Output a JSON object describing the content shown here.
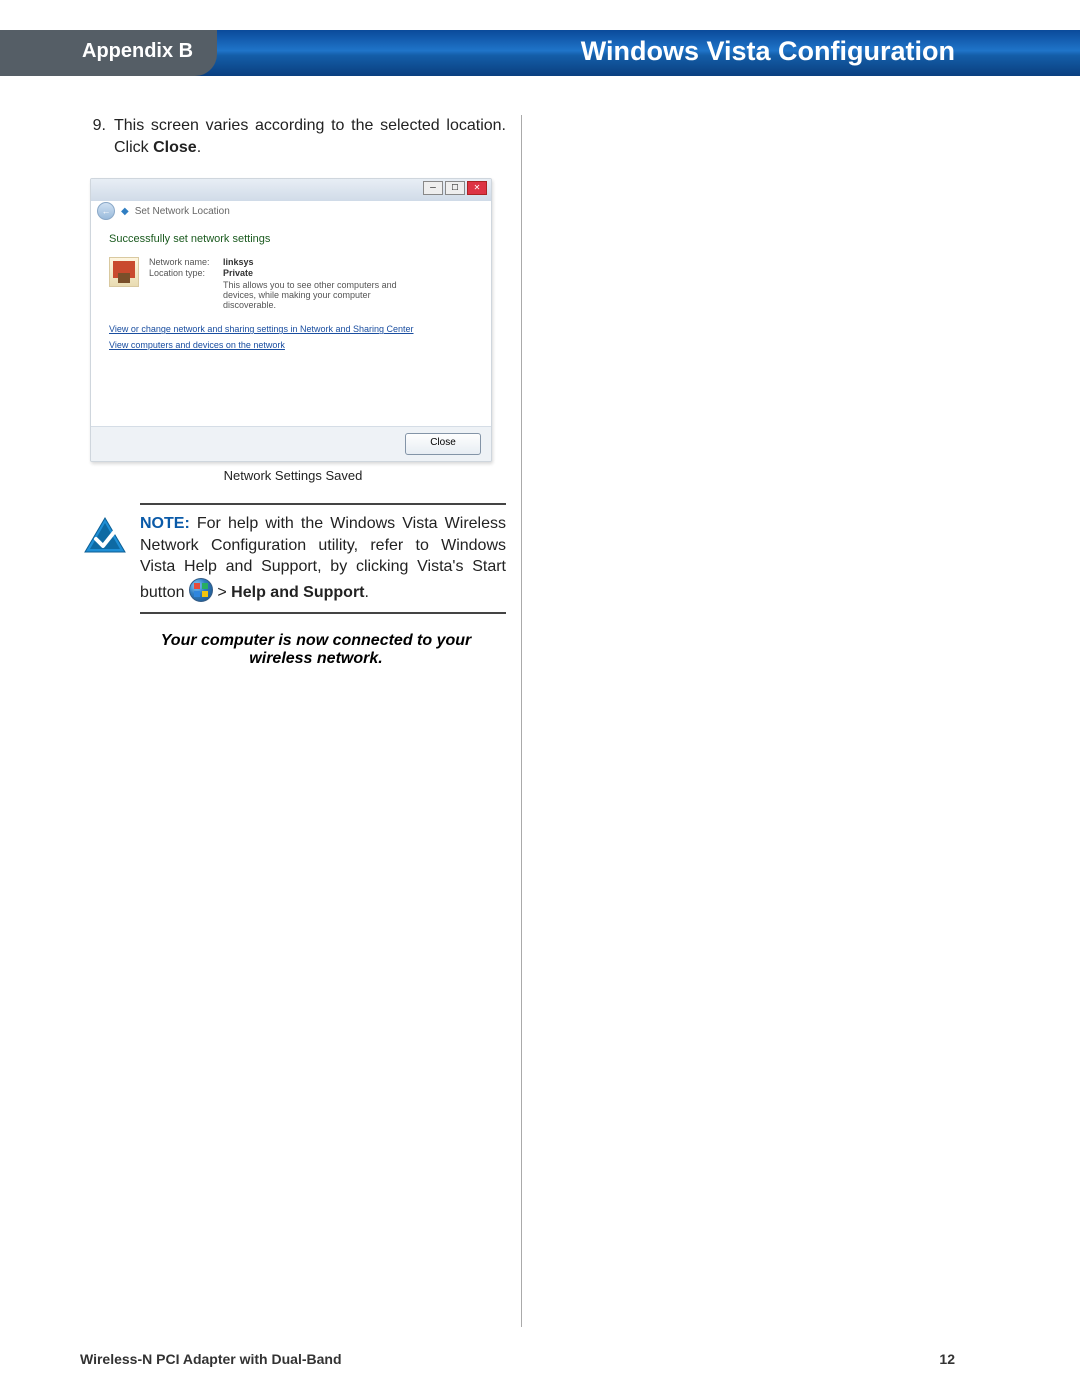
{
  "header": {
    "appendix": "Appendix B",
    "title": "Windows Vista Configuration"
  },
  "step": {
    "number": "9.",
    "text_pre": "This screen varies according to the selected location. Click ",
    "text_bold": "Close",
    "text_post": "."
  },
  "screenshot": {
    "window_title": "Set Network Location",
    "heading": "Successfully set network settings",
    "labels": {
      "network_name": "Network name:",
      "location_type": "Location type:"
    },
    "values": {
      "network_name": "linksys",
      "location_type": "Private"
    },
    "private_desc": "This allows you to see other computers and devices, while making your computer discoverable.",
    "link1": "View or change network and sharing settings in Network and Sharing Center",
    "link2": "View computers and devices on the network",
    "close_button": "Close",
    "caption": "Network Settings Saved"
  },
  "note": {
    "label": "NOTE:",
    "body_pre": " For help with the Windows Vista Wireless Network Configuration utility, refer to Windows Vista Help and Support, by clicking Vista's Start button ",
    "gt": " > ",
    "help_bold": "Help and Support",
    "period": "."
  },
  "connected": {
    "line1": "Your computer is now connected to your",
    "line2": "wireless network."
  },
  "footer": {
    "product": "Wireless-N PCI Adapter with Dual-Band",
    "page": "12"
  }
}
